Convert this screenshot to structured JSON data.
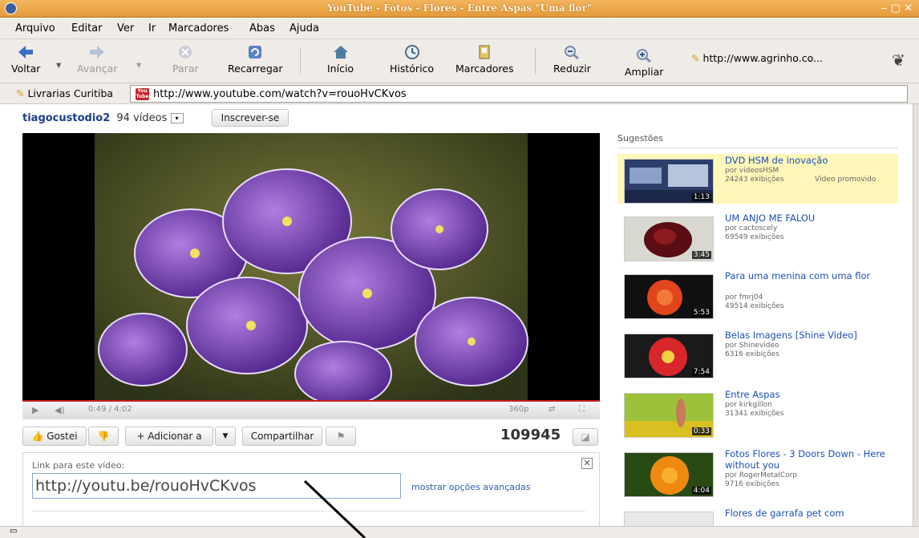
{
  "window": {
    "title": "YouTube - Fotos - Flores - Entre Aspas \"Uma flor\"",
    "controls": "‒ ▢ ✕"
  },
  "menu": [
    "Arquivo",
    "Editar",
    "Ver",
    "Ir",
    "Marcadores",
    "Abas",
    "Ajuda"
  ],
  "toolbar": {
    "back": "Voltar",
    "forward": "Avançar",
    "stop": "Parar",
    "reload": "Recarregar",
    "home": "Início",
    "history": "Histórico",
    "bookmarks": "Marcadores",
    "zoom_out": "Reduzir",
    "zoom_in": "Ampliar",
    "bookmark_link": "http://www.agrinho.co..."
  },
  "bookmarks_bar": {
    "item": "Livrarias Curitiba"
  },
  "address": {
    "url": "http://www.youtube.com/watch?v=rouoHvCKvos"
  },
  "channel": {
    "name": "tiagocustodio2",
    "videos": "94 vídeos",
    "subscribe": "Inscrever-se"
  },
  "player": {
    "time": "0:49 / 4:02",
    "quality": "360p",
    "progress": 0.2
  },
  "actions": {
    "like": "Gostei",
    "add": "Adicionar a",
    "share": "Compartilhar",
    "views": "109945"
  },
  "share": {
    "label": "Link para este vídeo:",
    "link": "http://youtu.be/rouoHvCKvos",
    "advanced": "mostrar opções avançadas"
  },
  "sidebar": {
    "heading": "Sugestões",
    "items": [
      {
        "title": "DVD HSM de inovação",
        "by": "por videosHSM",
        "views": "24243 exibições",
        "promo": "Vídeo promovido",
        "duration": "1:13"
      },
      {
        "title": "UM ANJO ME FALOU",
        "by": "por cactoscely",
        "views": "69549 exibições",
        "duration": "3:45"
      },
      {
        "title": "Para uma menina com uma flor",
        "by": "por fmrj04",
        "views": "49514 exibições",
        "duration": "5:53"
      },
      {
        "title": "Belas Imagens [Shine Video]",
        "by": "por Shinevideo",
        "views": "6316 exibições",
        "duration": "7:54"
      },
      {
        "title": "Entre Aspas",
        "by": "por kirkgillon",
        "views": "31341 exibições",
        "duration": "0:33"
      },
      {
        "title": "Fotos Flores - 3 Doors Down - Here without you",
        "by": "por RogerMetalCorp",
        "views": "9716 exibições",
        "duration": "4:04"
      },
      {
        "title": "Flores de garrafa pet com"
      }
    ]
  }
}
